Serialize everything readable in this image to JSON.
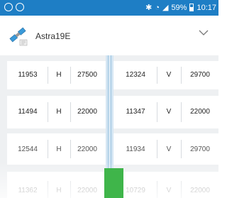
{
  "status_bar": {
    "battery": "59%",
    "time": "10:17"
  },
  "satellite": {
    "name": "Astra19E",
    "icon": "satellite-icon"
  },
  "rows": [
    {
      "left": {
        "freq": "11953",
        "pol": "H",
        "sr": "27500"
      },
      "right": {
        "freq": "12324",
        "pol": "V",
        "sr": "29700"
      }
    },
    {
      "left": {
        "freq": "11494",
        "pol": "H",
        "sr": "22000"
      },
      "right": {
        "freq": "11347",
        "pol": "V",
        "sr": "22000"
      }
    },
    {
      "left": {
        "freq": "12544",
        "pol": "H",
        "sr": "22000"
      },
      "right": {
        "freq": "11934",
        "pol": "V",
        "sr": "29700"
      }
    },
    {
      "left": {
        "freq": "11362",
        "pol": "H",
        "sr": "22000"
      },
      "right": {
        "freq": "10729",
        "pol": "V",
        "sr": "22000"
      }
    }
  ]
}
